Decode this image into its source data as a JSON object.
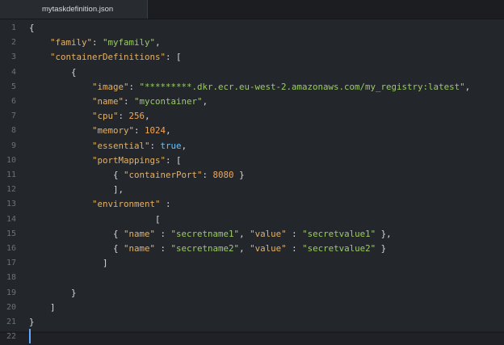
{
  "tab": {
    "filename": "mytaskdefinition.json"
  },
  "editor": {
    "lines": [
      [
        {
          "t": "{",
          "c": "p"
        }
      ],
      [
        {
          "t": "    ",
          "c": "p"
        },
        {
          "t": "\"family\"",
          "c": "k"
        },
        {
          "t": ": ",
          "c": "p"
        },
        {
          "t": "\"myfamily\"",
          "c": "s"
        },
        {
          "t": ",",
          "c": "p"
        }
      ],
      [
        {
          "t": "    ",
          "c": "p"
        },
        {
          "t": "\"containerDefinitions\"",
          "c": "k"
        },
        {
          "t": ": [",
          "c": "p"
        }
      ],
      [
        {
          "t": "        {",
          "c": "p"
        }
      ],
      [
        {
          "t": "            ",
          "c": "p"
        },
        {
          "t": "\"image\"",
          "c": "k"
        },
        {
          "t": ": ",
          "c": "p"
        },
        {
          "t": "\"*********.dkr.ecr.eu-west-2.amazonaws.com/my_registry:latest\"",
          "c": "s"
        },
        {
          "t": ",",
          "c": "p"
        }
      ],
      [
        {
          "t": "            ",
          "c": "p"
        },
        {
          "t": "\"name\"",
          "c": "k"
        },
        {
          "t": ": ",
          "c": "p"
        },
        {
          "t": "\"mycontainer\"",
          "c": "s"
        },
        {
          "t": ",",
          "c": "p"
        }
      ],
      [
        {
          "t": "            ",
          "c": "p"
        },
        {
          "t": "\"cpu\"",
          "c": "k"
        },
        {
          "t": ": ",
          "c": "p"
        },
        {
          "t": "256",
          "c": "n"
        },
        {
          "t": ",",
          "c": "p"
        }
      ],
      [
        {
          "t": "            ",
          "c": "p"
        },
        {
          "t": "\"memory\"",
          "c": "k"
        },
        {
          "t": ": ",
          "c": "p"
        },
        {
          "t": "1024",
          "c": "n"
        },
        {
          "t": ",",
          "c": "p"
        }
      ],
      [
        {
          "t": "            ",
          "c": "p"
        },
        {
          "t": "\"essential\"",
          "c": "k"
        },
        {
          "t": ": ",
          "c": "p"
        },
        {
          "t": "true",
          "c": "b"
        },
        {
          "t": ",",
          "c": "p"
        }
      ],
      [
        {
          "t": "            ",
          "c": "p"
        },
        {
          "t": "\"portMappings\"",
          "c": "k"
        },
        {
          "t": ": [",
          "c": "p"
        }
      ],
      [
        {
          "t": "                { ",
          "c": "p"
        },
        {
          "t": "\"containerPort\"",
          "c": "k"
        },
        {
          "t": ": ",
          "c": "p"
        },
        {
          "t": "8080",
          "c": "n"
        },
        {
          "t": " }",
          "c": "p"
        }
      ],
      [
        {
          "t": "                ],",
          "c": "p"
        }
      ],
      [
        {
          "t": "            ",
          "c": "p"
        },
        {
          "t": "\"environment\"",
          "c": "k"
        },
        {
          "t": " :",
          "c": "p"
        }
      ],
      [
        {
          "t": "                        [",
          "c": "p"
        }
      ],
      [
        {
          "t": "                { ",
          "c": "p"
        },
        {
          "t": "\"name\"",
          "c": "k"
        },
        {
          "t": " : ",
          "c": "p"
        },
        {
          "t": "\"secretname1\"",
          "c": "s"
        },
        {
          "t": ", ",
          "c": "p"
        },
        {
          "t": "\"value\"",
          "c": "k"
        },
        {
          "t": " : ",
          "c": "p"
        },
        {
          "t": "\"secretvalue1\"",
          "c": "s"
        },
        {
          "t": " },",
          "c": "p"
        }
      ],
      [
        {
          "t": "                { ",
          "c": "p"
        },
        {
          "t": "\"name\"",
          "c": "k"
        },
        {
          "t": " : ",
          "c": "p"
        },
        {
          "t": "\"secretname2\"",
          "c": "s"
        },
        {
          "t": ", ",
          "c": "p"
        },
        {
          "t": "\"value\"",
          "c": "k"
        },
        {
          "t": " : ",
          "c": "p"
        },
        {
          "t": "\"secretvalue2\"",
          "c": "s"
        },
        {
          "t": " }",
          "c": "p"
        }
      ],
      [
        {
          "t": "              ]",
          "c": "p"
        }
      ],
      [
        {
          "t": "",
          "c": "p"
        }
      ],
      [
        {
          "t": "        }",
          "c": "p"
        }
      ],
      [
        {
          "t": "    ]",
          "c": "p"
        }
      ],
      [
        {
          "t": "}",
          "c": "p"
        }
      ],
      [
        {
          "t": "",
          "c": "p"
        }
      ]
    ],
    "line_numbers": [
      "1",
      "2",
      "3",
      "4",
      "5",
      "6",
      "7",
      "8",
      "9",
      "10",
      "11",
      "12",
      "13",
      "14",
      "15",
      "16",
      "17",
      "18",
      "19",
      "20",
      "21",
      "22"
    ]
  },
  "colors": {
    "background": "#23262b",
    "string": "#9ccc65",
    "key": "#e3b26a",
    "number": "#f2a65a",
    "boolean": "#67c3ff",
    "cursor": "#61a8ff"
  }
}
